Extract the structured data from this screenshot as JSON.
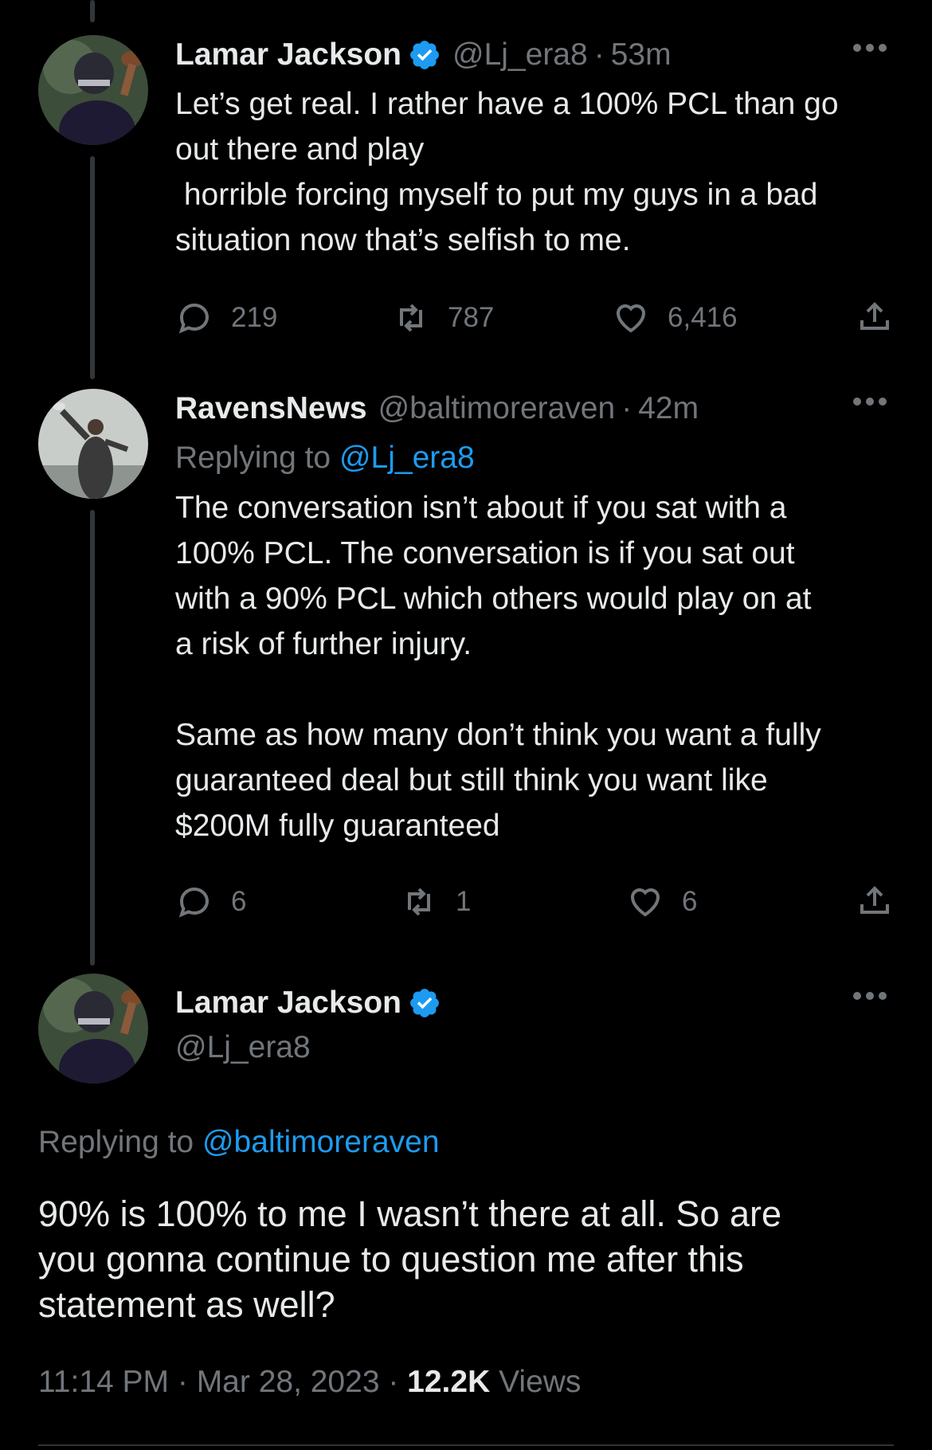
{
  "tweets": [
    {
      "name": "Lamar Jackson",
      "handle": "@Lj_era8",
      "time": "53m",
      "text": "Let’s get real. I rather have a 100% PCL than go\nout there and play\n horrible forcing myself to put my guys in a bad\nsituation now that’s selfish to me.",
      "replies": "219",
      "retweets": "787",
      "likes": "6,416"
    },
    {
      "name": "RavensNews",
      "handle": "@baltimoreraven",
      "time": "42m",
      "replying_label": "Replying to",
      "replying_to": "@Lj_era8",
      "text": "The conversation isn’t about if you sat with a\n100% PCL. The conversation is if you sat out\nwith a 90% PCL which others would play on at\na risk of further injury.\n\nSame as how many don’t think you want a fully\nguaranteed deal but still think you want like\n$200M fully guaranteed",
      "replies": "6",
      "retweets": "1",
      "likes": "6"
    }
  ],
  "main_tweet": {
    "name": "Lamar Jackson",
    "handle": "@Lj_era8",
    "replying_label": "Replying to",
    "replying_to": "@baltimoreraven",
    "text": "90% is 100% to me I wasn’t there at all. So are\nyou gonna continue to question me after this\nstatement as well?",
    "timestamp": "11:14 PM · Mar 28, 2023 ·",
    "views_count": "12.2K",
    "views_label": "Views"
  },
  "dot": "·",
  "colors": {
    "background": "#000000",
    "text": "#e7e9ea",
    "muted": "#71767b",
    "link": "#1d9bf0",
    "verified": "#1d9bf0"
  },
  "icons": [
    "verified-badge-icon",
    "more-icon",
    "reply-icon",
    "retweet-icon",
    "like-icon",
    "share-icon"
  ]
}
